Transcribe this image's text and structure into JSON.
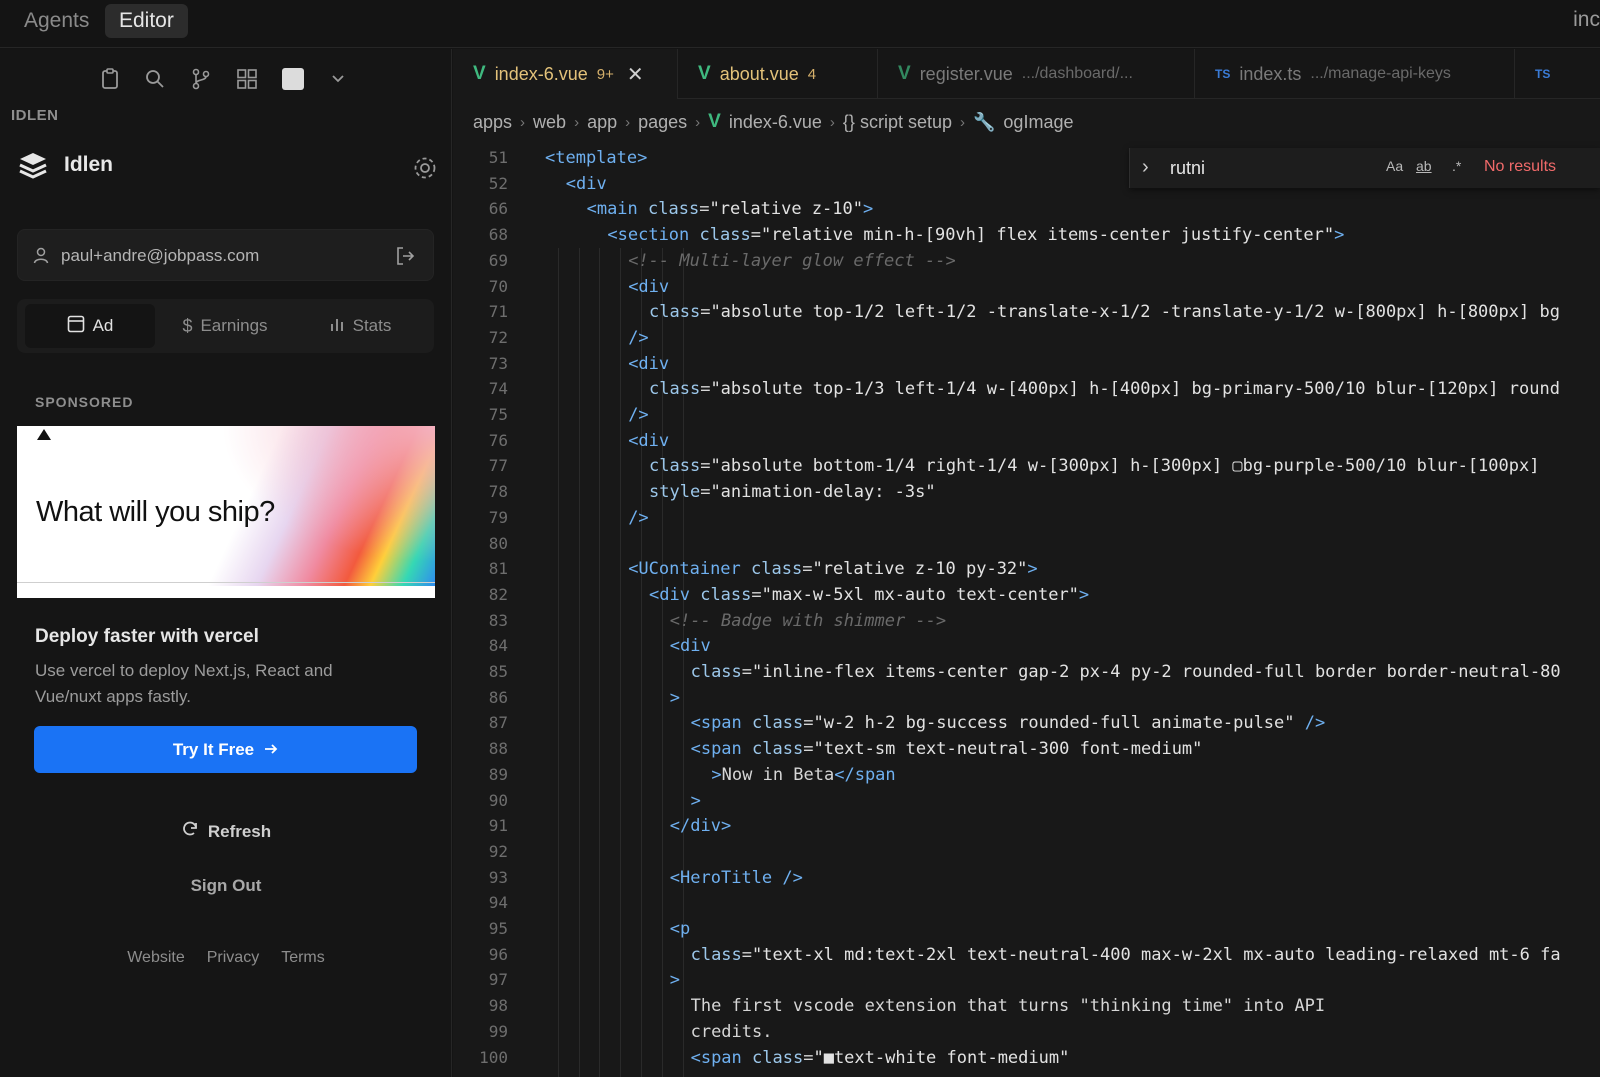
{
  "topbar": {
    "modes": [
      "Agents",
      "Editor"
    ],
    "active_mode": "Editor",
    "right_text": "inc"
  },
  "sidebar": {
    "toolbar_icons": [
      "clipboard-icon",
      "search-icon",
      "branch-icon",
      "extensions-icon",
      "square-icon",
      "chevron-down-icon"
    ],
    "section_title": "IDLEN",
    "app_name": "Idlen",
    "user_email": "paul+andre@jobpass.com",
    "tabs": [
      {
        "label": "Ad",
        "icon": "ad-icon"
      },
      {
        "label": "Earnings",
        "icon": "dollar-icon"
      },
      {
        "label": "Stats",
        "icon": "bar-chart-icon"
      }
    ],
    "active_tab": "Ad",
    "sponsored_label": "SPONSORED",
    "ad": {
      "headline": "What will you ship?",
      "title": "Deploy faster with vercel",
      "description": "Use vercel to deploy Next.js, React and Vue/nuxt apps fastly.",
      "cta": "Try It Free"
    },
    "refresh_label": "Refresh",
    "signout_label": "Sign Out",
    "footer_links": [
      "Website",
      "Privacy",
      "Terms"
    ]
  },
  "editor": {
    "tabs": [
      {
        "name": "index-6.vue",
        "badge": "9+",
        "type": "vue",
        "active": true
      },
      {
        "name": "about.vue",
        "badge": "4",
        "type": "vue",
        "active": false
      },
      {
        "name": "register.vue",
        "path": ".../dashboard/...",
        "type": "vue",
        "active": false
      },
      {
        "name": "index.ts",
        "path": ".../manage-api-keys",
        "type": "ts",
        "active": false
      },
      {
        "name": "",
        "type": "ts",
        "active": false
      }
    ],
    "breadcrumbs": [
      "apps",
      "web",
      "app",
      "pages",
      "index-6.vue",
      "{} script setup",
      "ogImage"
    ],
    "find": {
      "query": "rutni",
      "options": [
        "Aa",
        "ab",
        ".*"
      ],
      "result": "No results"
    },
    "lines": [
      {
        "n": "51",
        "html": "<span class=\"tag\">&lt;template&gt;</span>",
        "indent": 0
      },
      {
        "n": "52",
        "html": "<span class=\"tag\">&lt;div</span>",
        "indent": 1
      },
      {
        "n": "66",
        "html": "<span class=\"tag\">&lt;main</span> <span class=\"attr\">class</span>=<span class=\"str\">\"relative z-10\"</span><span class=\"tag\">&gt;</span>",
        "indent": 2
      },
      {
        "n": "68",
        "html": "<span class=\"tag\">&lt;section</span> <span class=\"attr\">class</span>=<span class=\"str\">\"relative min-h-[90vh] flex items-center justify-center\"</span><span class=\"tag\">&gt;</span>",
        "indent": 3
      },
      {
        "n": "69",
        "html": "<span class=\"cmt\">&lt;!-- Multi-layer glow effect --&gt;</span>",
        "indent": 4
      },
      {
        "n": "70",
        "html": "<span class=\"tag\">&lt;div</span>",
        "indent": 4
      },
      {
        "n": "71",
        "html": "<span class=\"attr\">class</span>=<span class=\"str\">\"absolute top-1/2 left-1/2 -translate-x-1/2 -translate-y-1/2 w-[800px] h-[800px] bg</span>",
        "indent": 5
      },
      {
        "n": "72",
        "html": "<span class=\"tag\">/&gt;</span>",
        "indent": 4
      },
      {
        "n": "73",
        "html": "<span class=\"tag\">&lt;div</span>",
        "indent": 4
      },
      {
        "n": "74",
        "html": "<span class=\"attr\">class</span>=<span class=\"str\">\"absolute top-1/3 left-1/4 w-[400px] h-[400px] bg-primary-500/10 blur-[120px] round</span>",
        "indent": 5
      },
      {
        "n": "75",
        "html": "<span class=\"tag\">/&gt;</span>",
        "indent": 4
      },
      {
        "n": "76",
        "html": "<span class=\"tag\">&lt;div</span>",
        "indent": 4
      },
      {
        "n": "77",
        "html": "<span class=\"attr\">class</span>=<span class=\"str\">\"absolute bottom-1/4 right-1/4 w-[300px] h-[300px] ▢bg-purple-500/10 blur-[100px]</span>",
        "indent": 5
      },
      {
        "n": "78",
        "html": "<span class=\"attr\">style</span>=<span class=\"str\">\"animation-delay: -3s\"</span>",
        "indent": 5
      },
      {
        "n": "79",
        "html": "<span class=\"tag\">/&gt;</span>",
        "indent": 4
      },
      {
        "n": "80",
        "html": "",
        "indent": 0
      },
      {
        "n": "81",
        "html": "<span class=\"tag\">&lt;UContainer</span> <span class=\"attr\">class</span>=<span class=\"str\">\"relative z-10 py-32\"</span><span class=\"tag\">&gt;</span>",
        "indent": 4
      },
      {
        "n": "82",
        "html": "<span class=\"tag\">&lt;div</span> <span class=\"attr\">class</span>=<span class=\"str\">\"max-w-5xl mx-auto text-center\"</span><span class=\"tag\">&gt;</span>",
        "indent": 5
      },
      {
        "n": "83",
        "html": "<span class=\"cmt\">&lt;!-- Badge with shimmer --&gt;</span>",
        "indent": 6
      },
      {
        "n": "84",
        "html": "<span class=\"tag\">&lt;div</span>",
        "indent": 6
      },
      {
        "n": "85",
        "html": "<span class=\"attr\">class</span>=<span class=\"str\">\"inline-flex items-center gap-2 px-4 py-2 rounded-full border border-neutral-80</span>",
        "indent": 7
      },
      {
        "n": "86",
        "html": "<span class=\"tag\">&gt;</span>",
        "indent": 6
      },
      {
        "n": "87",
        "html": "<span class=\"tag\">&lt;span</span> <span class=\"attr\">class</span>=<span class=\"str\">\"w-2 h-2 bg-success rounded-full animate-pulse\"</span> <span class=\"tag\">/&gt;</span>",
        "indent": 7
      },
      {
        "n": "88",
        "html": "<span class=\"tag\">&lt;span</span> <span class=\"attr\">class</span>=<span class=\"str\">\"text-sm text-neutral-300 font-medium\"</span>",
        "indent": 7
      },
      {
        "n": "89",
        "html": "<span class=\"tag\">&gt;</span>Now in Beta<span class=\"tag\">&lt;/span</span>",
        "indent": 8
      },
      {
        "n": "90",
        "html": "<span class=\"tag\">&gt;</span>",
        "indent": 7
      },
      {
        "n": "91",
        "html": "<span class=\"tag\">&lt;/div&gt;</span>",
        "indent": 6
      },
      {
        "n": "92",
        "html": "",
        "indent": 0
      },
      {
        "n": "93",
        "html": "<span class=\"tag\">&lt;HeroTitle</span> <span class=\"tag\">/&gt;</span>",
        "indent": 6
      },
      {
        "n": "94",
        "html": "",
        "indent": 0
      },
      {
        "n": "95",
        "html": "<span class=\"tag\">&lt;p</span>",
        "indent": 6
      },
      {
        "n": "96",
        "html": "<span class=\"attr\">class</span>=<span class=\"str\">\"text-xl md:text-2xl text-neutral-400 max-w-2xl mx-auto leading-relaxed mt-6 fa</span>",
        "indent": 7
      },
      {
        "n": "97",
        "html": "<span class=\"tag\">&gt;</span>",
        "indent": 6
      },
      {
        "n": "98",
        "html": "The first vscode extension that turns \"thinking time\" into API",
        "indent": 7
      },
      {
        "n": "99",
        "html": "credits.",
        "indent": 7
      },
      {
        "n": "100",
        "html": "<span class=\"tag\">&lt;span</span> <span class=\"attr\">class</span>=<span class=\"str\">\"■text-white font-medium\"</span>",
        "indent": 7
      }
    ]
  }
}
